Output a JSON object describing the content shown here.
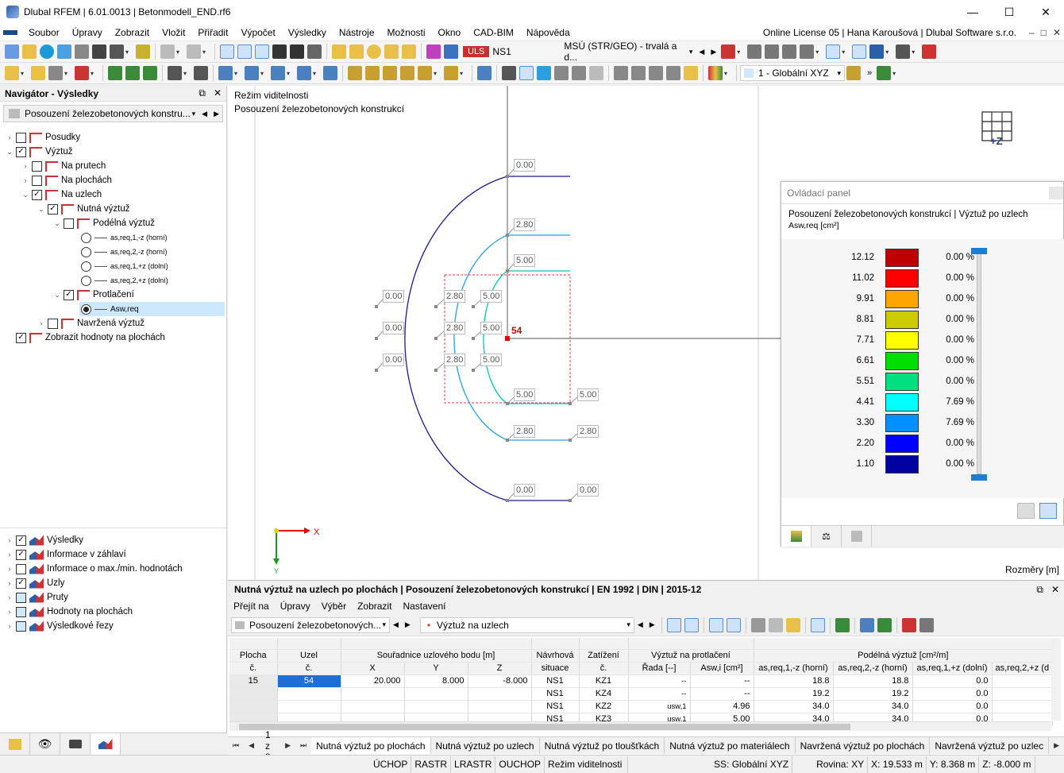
{
  "window": {
    "title": "Dlubal RFEM | 6.01.0013 | Betonmodell_END.rf6",
    "min": "—",
    "max": "☐",
    "close": "✕"
  },
  "menu": {
    "items": [
      "Soubor",
      "Úpravy",
      "Zobrazit",
      "Vložit",
      "Přiřadit",
      "Výpočet",
      "Výsledky",
      "Nástroje",
      "Možnosti",
      "Okno",
      "CAD-BIM",
      "Nápověda"
    ],
    "license": "Online License 05 | Hana Karoušová | Dlubal Software s.r.o.",
    "mdi_min": "–",
    "mdi_max": "□",
    "mdi_close": "✕"
  },
  "toolbar": {
    "uls": "ULS",
    "ns": "NS1",
    "combo": "MSÚ (STR/GEO) - trvalá a d...",
    "coord_system": "1 - Globální XYZ"
  },
  "navigator": {
    "title": "Navigátor - Výsledky",
    "combo": "Posouzení železobetonových konstru...",
    "tree": {
      "posudky": "Posudky",
      "vyztuz": "Výztuž",
      "na_prutech": "Na prutech",
      "na_plochach": "Na plochách",
      "na_uzlech": "Na uzlech",
      "nutna_vyztuz": "Nutná výztuž",
      "podelna_vyztuz": "Podélná výztuž",
      "as1": "as,req,1,-z (horní)",
      "as2": "as,req,2,-z (horní)",
      "as3": "as,req,1,+z (dolní)",
      "as4": "as,req,2,+z (dolní)",
      "protlaceni": "Protlačení",
      "asw": "Asw,req",
      "navrzena_vyztuz": "Navržená výztuž",
      "zobrazit_hodnoty": "Zobrazit hodnoty na plochách"
    },
    "bottom_tree": [
      "Výsledky",
      "Informace v záhlaví",
      "Informace o max./min. hodnotách",
      "Uzly",
      "Pruty",
      "Hodnoty na plochách",
      "Výsledkové řezy"
    ]
  },
  "viewport": {
    "mode_text": "Režim viditelnosti",
    "subtitle": "Posouzení železobetonových konstrukcí",
    "dims": "Rozměry [m]",
    "cube_label": "+Z",
    "node_label": "54",
    "axis_x": "X",
    "axis_y": "Y",
    "labels": {
      "outer_top": "0.00",
      "outer_left_1": "0.00",
      "outer_left_2": "0.00",
      "outer_left_3": "0.00",
      "outer_bottom_1": "0.00",
      "outer_bottom_2": "0.00",
      "mid_top": "2.80",
      "mid_left_1": "2.80",
      "mid_left_2": "2.80",
      "mid_left_3": "2.80",
      "mid_bottom_1": "2.80",
      "mid_bottom_2": "2.80",
      "in_top": "5.00",
      "in_left_1": "5.00",
      "in_left_2": "5.00",
      "in_left_3": "5.00",
      "in_bottom_1": "5.00",
      "in_bottom_2": "5.00"
    }
  },
  "control_panel": {
    "title": "Ovládací panel",
    "subtitle": "Posouzení železobetonových konstrukcí | Výztuž po uzlech",
    "unit": "Asw,req [cm²]",
    "legend": [
      {
        "value": "12.12",
        "color": "#c00000",
        "pct": "0.00 %"
      },
      {
        "value": "11.02",
        "color": "#ff0000",
        "pct": "0.00 %"
      },
      {
        "value": "9.91",
        "color": "#ffa500",
        "pct": "0.00 %"
      },
      {
        "value": "8.81",
        "color": "#cccc00",
        "pct": "0.00 %"
      },
      {
        "value": "7.71",
        "color": "#ffff00",
        "pct": "0.00 %"
      },
      {
        "value": "6.61",
        "color": "#00e000",
        "pct": "0.00 %"
      },
      {
        "value": "5.51",
        "color": "#00e080",
        "pct": "0.00 %"
      },
      {
        "value": "4.41",
        "color": "#00ffff",
        "pct": "7.69 %"
      },
      {
        "value": "3.30",
        "color": "#0090ff",
        "pct": "7.69 %"
      },
      {
        "value": "2.20",
        "color": "#0000ff",
        "pct": "0.00 %"
      },
      {
        "value": "1.10",
        "color": "#0000a0",
        "pct": "0.00 %"
      }
    ]
  },
  "table_panel": {
    "title": "Nutná výztuž na uzlech po plochách | Posouzení železobetonových konstrukcí | EN 1992 | DIN | 2015-12",
    "menu": [
      "Přejít na",
      "Úpravy",
      "Výběr",
      "Zobrazit",
      "Nastavení"
    ],
    "combo1": "Posouzení železobetonových...",
    "combo2": "Výztuž na uzlech",
    "headers": {
      "plocha": "Plocha",
      "c": "č.",
      "uzel": "Uzel",
      "coords": "Souřadnice uzlového bodu [m]",
      "x": "X",
      "y": "Y",
      "z": "Z",
      "navrhova": "Návrhová",
      "situace": "situace",
      "zatizeni": "Zatížení",
      "vyztuz_prot": "Výztuž na protlačení",
      "rada": "Řada [--]",
      "aswi": "Asw,i [cm²]",
      "podelna": "Podélná výztuž [cm²/m]",
      "a1": "as,req,1,-z (horní)",
      "a2": "as,req,2,-z (horní)",
      "a3": "as,req,1,+z (dolní)",
      "a4": "as,req,2,+z (d"
    },
    "rows": [
      {
        "plocha": "15",
        "uzel": "54",
        "x": "20.000",
        "y": "8.000",
        "z": "-8.000",
        "ns": "NS1",
        "kz": "KZ1",
        "rada": "--",
        "asw": "--",
        "a1": "18.8",
        "a2": "18.8",
        "a3": "0.0",
        "a4": ""
      },
      {
        "plocha": "",
        "uzel": "",
        "x": "",
        "y": "",
        "z": "",
        "ns": "NS1",
        "kz": "KZ4",
        "rada": "--",
        "asw": "--",
        "a1": "19.2",
        "a2": "19.2",
        "a3": "0.0",
        "a4": ""
      },
      {
        "plocha": "",
        "uzel": "",
        "x": "",
        "y": "",
        "z": "",
        "ns": "NS1",
        "kz": "KZ2",
        "rada": "usw,1",
        "asw": "4.96",
        "a1": "34.0",
        "a2": "34.0",
        "a3": "0.0",
        "a4": ""
      },
      {
        "plocha": "",
        "uzel": "",
        "x": "",
        "y": "",
        "z": "",
        "ns": "NS1",
        "kz": "KZ3",
        "rada": "usw,1",
        "asw": "5.00",
        "a1": "34.0",
        "a2": "34.0",
        "a3": "0.0",
        "a4": ""
      }
    ],
    "pager": "1 z 8",
    "tabs": [
      "Nutná výztuž po plochách",
      "Nutná výztuž po uzlech",
      "Nutná výztuž po tloušťkách",
      "Nutná výztuž po materiálech",
      "Navržená výztuž po plochách",
      "Navržená výztuž po uzlec"
    ]
  },
  "status": {
    "items": [
      "ÚCHOP",
      "RASTR",
      "LRASTR",
      "OUCHOP",
      "Režim viditelnosti"
    ],
    "ss": "SS: Globální XYZ",
    "rovina": "Rovina: XY",
    "x": "X: 19.533 m",
    "y": "Y: 8.368 m",
    "z": "Z: -8.000 m"
  }
}
